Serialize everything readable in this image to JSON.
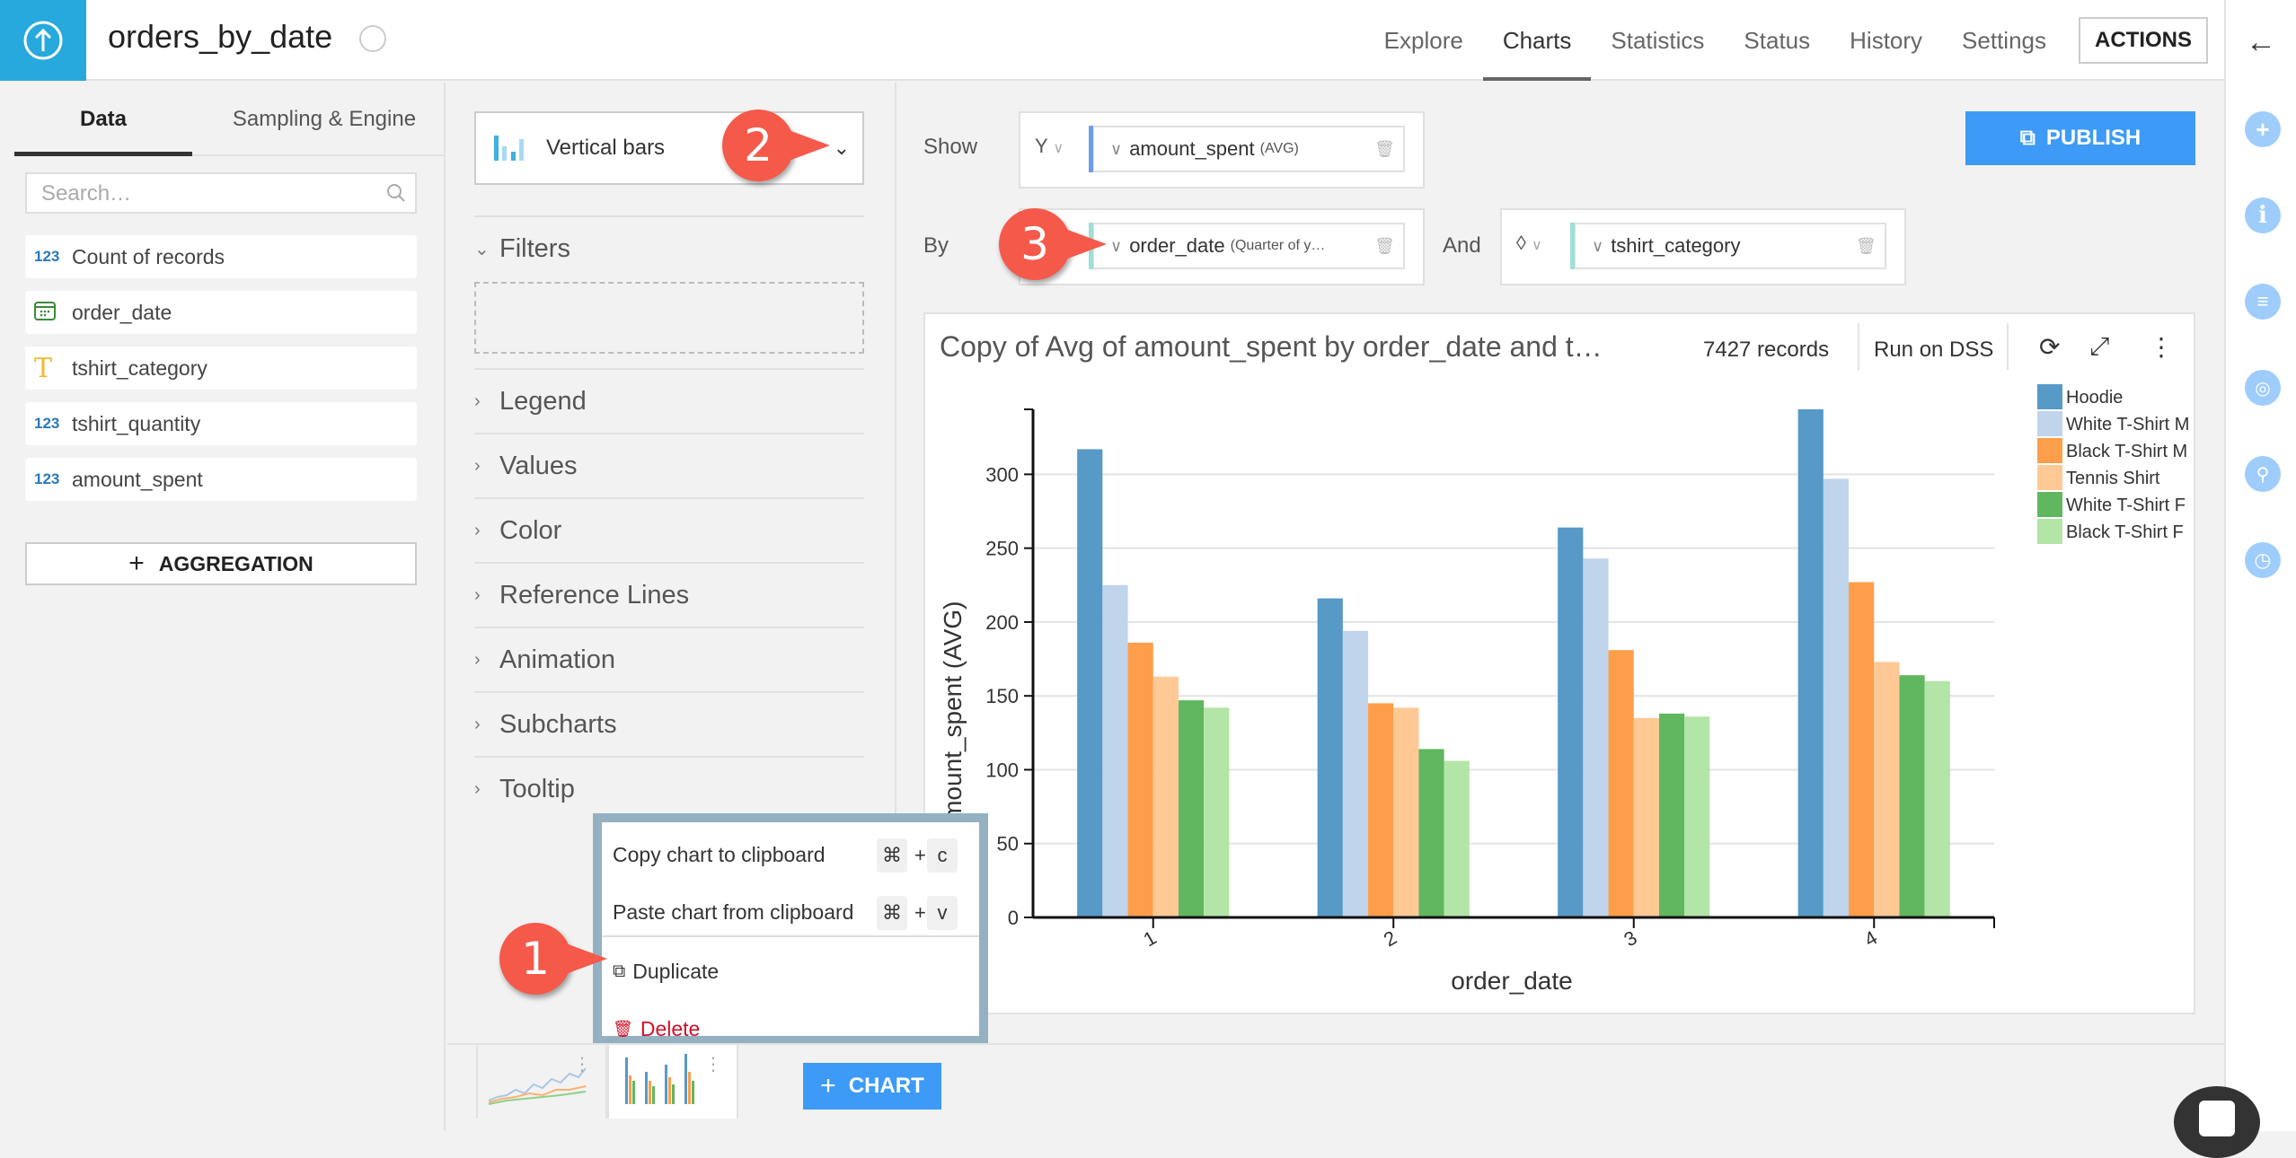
{
  "header": {
    "dataset_name": "orders_by_date",
    "nav": [
      "Explore",
      "Charts",
      "Statistics",
      "Status",
      "History",
      "Settings"
    ],
    "active_nav": "Charts",
    "actions_label": "ACTIONS"
  },
  "left_panel": {
    "tabs": [
      "Data",
      "Sampling & Engine"
    ],
    "active_tab": "Data",
    "search_placeholder": "Search…",
    "fields": [
      {
        "type_icon": "123",
        "name": "Count of records"
      },
      {
        "type_icon": "calendar",
        "name": "order_date"
      },
      {
        "type_icon": "T",
        "name": "tshirt_category"
      },
      {
        "type_icon": "123",
        "name": "tshirt_quantity"
      },
      {
        "type_icon": "123",
        "name": "amount_spent"
      }
    ],
    "aggregation_button": "AGGREGATION"
  },
  "middle_panel": {
    "chart_type": "Vertical bars",
    "sections": [
      "Filters",
      "Legend",
      "Values",
      "Color",
      "Reference Lines",
      "Animation",
      "Subcharts",
      "Tooltip"
    ]
  },
  "config": {
    "show_label": "Show",
    "y_selector": "Y",
    "measure": "amount_spent",
    "measure_agg": "(AVG)",
    "by_label": "By",
    "dimension": "order_date",
    "dimension_detail": "(Quarter of y…",
    "and_label": "And",
    "color_dimension": "tshirt_category",
    "publish_label": "PUBLISH"
  },
  "chart_card": {
    "title": "Copy of Avg of amount_spent by order_date and t…",
    "records": "7427 records",
    "run_on": "Run on DSS"
  },
  "context_menu": {
    "items": [
      {
        "label": "Copy chart to clipboard",
        "shortcut_mod": "⌘",
        "shortcut_key": "c"
      },
      {
        "label": "Paste chart from clipboard",
        "shortcut_mod": "⌘",
        "shortcut_key": "v"
      },
      {
        "label": "Duplicate"
      },
      {
        "label": "Delete"
      }
    ],
    "plus": "+"
  },
  "bottom_bar": {
    "add_chart_label": "CHART"
  },
  "callouts": [
    "1",
    "2",
    "3"
  ],
  "colors": {
    "accent": "#3d9bf7",
    "logo": "#28a9dd",
    "delete": "#d0112b",
    "callout": "#f5594a"
  },
  "chart_data": {
    "type": "bar",
    "title": "Copy of Avg of amount_spent by order_date and t…",
    "xlabel": "order_date",
    "ylabel": "amount_spent (AVG)",
    "categories": [
      "1",
      "2",
      "3",
      "4"
    ],
    "ylim": [
      0,
      344
    ],
    "yticks": [
      0,
      50,
      100,
      150,
      200,
      250,
      300
    ],
    "grid": true,
    "legend_position": "top-right",
    "series": [
      {
        "name": "Hoodie",
        "color": "#5799c7",
        "values": [
          317,
          216,
          264,
          344
        ]
      },
      {
        "name": "White T-Shirt M",
        "color": "#c0d4ec",
        "values": [
          225,
          194,
          243,
          297
        ]
      },
      {
        "name": "Black T-Shirt M",
        "color": "#ff9e4a",
        "values": [
          186,
          145,
          181,
          227
        ]
      },
      {
        "name": "Tennis Shirt",
        "color": "#ffc996",
        "values": [
          163,
          142,
          135,
          173
        ]
      },
      {
        "name": "White T-Shirt F",
        "color": "#60b75f",
        "values": [
          147,
          114,
          138,
          164
        ]
      },
      {
        "name": "Black T-Shirt F",
        "color": "#b2e5a6",
        "values": [
          142,
          106,
          136,
          160
        ]
      }
    ]
  }
}
